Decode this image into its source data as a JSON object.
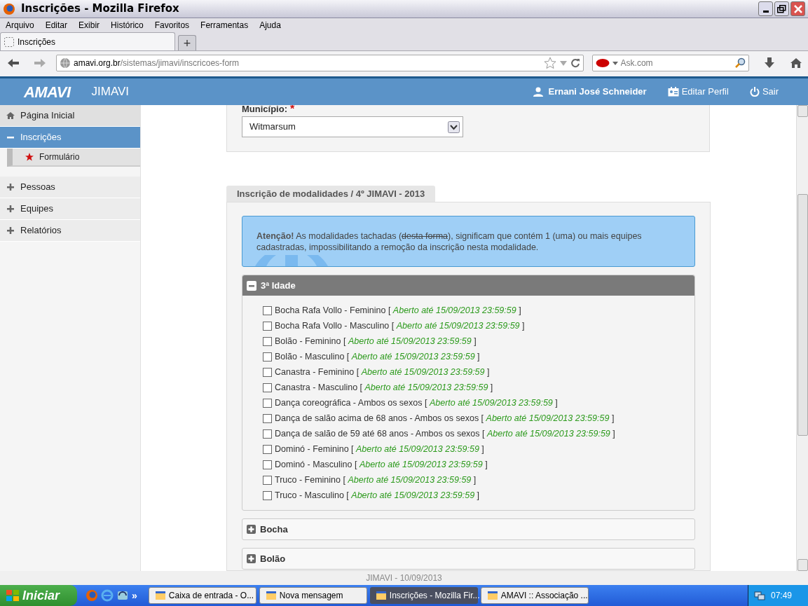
{
  "window": {
    "title": "Inscrições - Mozilla Firefox"
  },
  "menu": [
    "Arquivo",
    "Editar",
    "Exibir",
    "Histórico",
    "Favoritos",
    "Ferramentas",
    "Ajuda"
  ],
  "tabs": [
    {
      "label": "Inscrições",
      "selected": true
    }
  ],
  "new_tab": "+",
  "address": {
    "domain": "amavi.org.br",
    "path": "/sistemas/jimavi/inscricoes-form"
  },
  "search": {
    "placeholder": "Ask.com"
  },
  "app": {
    "logo": "AMAVI",
    "title": "JIMAVI",
    "user": "Ernani José Schneider",
    "edit_profile": "Editar Perfil",
    "logout": "Sair"
  },
  "sidebar": {
    "items": [
      {
        "label": "Página Inicial",
        "kind": "home"
      },
      {
        "label": "Inscrições",
        "kind": "group",
        "expanded": true,
        "children": [
          {
            "label": "Formulário",
            "selected": true
          }
        ]
      },
      {
        "label": "Pessoas",
        "kind": "group",
        "expanded": false
      },
      {
        "label": "Equipes",
        "kind": "group",
        "expanded": false
      },
      {
        "label": "Relatórios",
        "kind": "group",
        "expanded": false
      }
    ]
  },
  "form": {
    "label": "Município:",
    "required_mark": "*",
    "value": "Witmarsum"
  },
  "section": {
    "title": "Inscrição de modalidades / 4º JIMAVI - 2013",
    "alert": {
      "lead": "Atenção!",
      "before": " As modalidades tachadas (",
      "struck": "desta forma",
      "after": "), significam que contém 1 (uma) ou mais equipes cadastradas, impossibilitando a remoção da inscrição nesta modalidade."
    },
    "groups": [
      {
        "title": "3ª Idade",
        "expanded": true,
        "items": [
          {
            "name": "Bocha Rafa Vollo - Feminino",
            "open": "[",
            "status": "Aberto até 15/09/2013 23:59:59",
            "close": "]",
            "checked": false
          },
          {
            "name": "Bocha Rafa Vollo - Masculino",
            "open": "[",
            "status": "Aberto até 15/09/2013 23:59:59",
            "close": "]",
            "checked": false
          },
          {
            "name": "Bolão - Feminino",
            "open": "[",
            "status": "Aberto até 15/09/2013 23:59:59",
            "close": "]",
            "checked": false
          },
          {
            "name": "Bolão - Masculino",
            "open": "[",
            "status": "Aberto até 15/09/2013 23:59:59",
            "close": "]",
            "checked": false
          },
          {
            "name": "Canastra - Feminino",
            "open": "[",
            "status": "Aberto até 15/09/2013 23:59:59",
            "close": "]",
            "checked": false
          },
          {
            "name": "Canastra - Masculino",
            "open": "[",
            "status": "Aberto até 15/09/2013 23:59:59",
            "close": "]",
            "checked": false
          },
          {
            "name": "Dança coreográfica - Ambos os sexos",
            "open": "[",
            "status": "Aberto até 15/09/2013 23:59:59",
            "close": "]",
            "checked": false
          },
          {
            "name": "Dança de salão acima de 68 anos - Ambos os sexos",
            "open": "[",
            "status": "Aberto até 15/09/2013 23:59:59",
            "close": "]",
            "checked": false
          },
          {
            "name": "Dança de salão de 59 até 68 anos - Ambos os sexos",
            "open": "[",
            "status": "Aberto até 15/09/2013 23:59:59",
            "close": "]",
            "checked": false
          },
          {
            "name": "Dominó - Feminino",
            "open": "[",
            "status": "Aberto até 15/09/2013 23:59:59",
            "close": "]",
            "checked": false
          },
          {
            "name": "Dominó - Masculino",
            "open": "[",
            "status": "Aberto até 15/09/2013 23:59:59",
            "close": "]",
            "checked": false
          },
          {
            "name": "Truco - Feminino",
            "open": "[",
            "status": "Aberto até 15/09/2013 23:59:59",
            "close": "]",
            "checked": false
          },
          {
            "name": "Truco - Masculino",
            "open": "[",
            "status": "Aberto até 15/09/2013 23:59:59",
            "close": "]",
            "checked": false
          }
        ]
      },
      {
        "title": "Bocha",
        "expanded": false
      },
      {
        "title": "Bolão",
        "expanded": false
      }
    ]
  },
  "footer": "JIMAVI - 10/09/2013",
  "taskbar": {
    "start": "Iniciar",
    "more": "»",
    "tasks": [
      {
        "label": "Caixa de entrada - O...",
        "selected": false
      },
      {
        "label": "Nova mensagem",
        "selected": false
      },
      {
        "label": "Inscrições - Mozilla Fir...",
        "selected": true
      },
      {
        "label": "AMAVI :: Associação ...",
        "selected": false
      }
    ],
    "clock": "07:49"
  }
}
